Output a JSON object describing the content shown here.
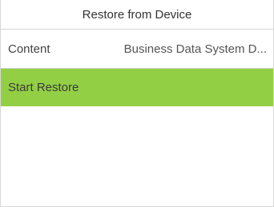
{
  "header": {
    "title": "Restore from Device"
  },
  "menu": {
    "content_label": "Content",
    "content_value": "Business Data System D...",
    "start_restore_label": "Start Restore"
  },
  "colors": {
    "highlight": "#93cf45",
    "divider": "#d6d6d6",
    "background": "#ffffff"
  }
}
